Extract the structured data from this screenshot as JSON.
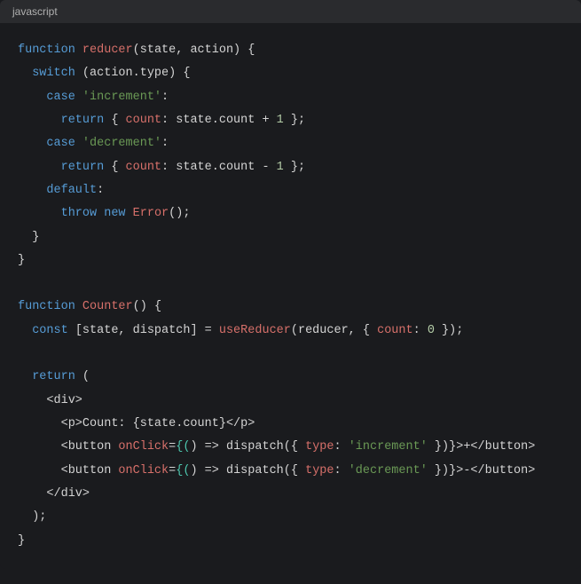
{
  "header": {
    "language": "javascript"
  },
  "code": {
    "l1": {
      "kw": "function",
      "fn": "reducer",
      "params": "(state, action) {"
    },
    "l2": {
      "kw": "switch",
      "expr": " (action.type) {"
    },
    "l3": {
      "kw": "case",
      "str": "'increment'",
      "colon": ":"
    },
    "l4": {
      "kw": "return",
      "brace": " { ",
      "prop": "count",
      "rest": ": state.count + ",
      "num": "1",
      "end": " };"
    },
    "l5": {
      "kw": "case",
      "str": "'decrement'",
      "colon": ":"
    },
    "l6": {
      "kw": "return",
      "brace": " { ",
      "prop": "count",
      "rest": ": state.count - ",
      "num": "1",
      "end": " };"
    },
    "l7": {
      "kw": "default",
      "colon": ":"
    },
    "l8": {
      "kw": "throw",
      "kw2": "new",
      "fn": "Error",
      "end": "();"
    },
    "l9": {
      "brace": "  }"
    },
    "l10": {
      "brace": "}"
    },
    "l11": {
      "kw": "function",
      "fn": "Counter",
      "params": "() {"
    },
    "l12": {
      "kw": "const",
      "lhs": " [state, dispatch] = ",
      "fn": "useReducer",
      "args1": "(reducer, { ",
      "prop": "count",
      "args2": ": ",
      "num": "0",
      "args3": " });"
    },
    "l13": {
      "kw": "return",
      "paren": " ("
    },
    "l14": {
      "txt": "    <div>"
    },
    "l15": {
      "txt": "      <p>Count: {state.count}</p>"
    },
    "l16": {
      "pre": "      <button ",
      "attr": "onClick",
      "eq": "=",
      "bo": "{(",
      "paren": ")",
      "arrow": " => ",
      "call": "dispatch({ ",
      "prop": "type",
      "colon": ": ",
      "str": "'increment'",
      "end": " })}>+</button>"
    },
    "l17": {
      "pre": "      <button ",
      "attr": "onClick",
      "eq": "=",
      "bo": "{(",
      "paren": ")",
      "arrow": " => ",
      "call": "dispatch({ ",
      "prop": "type",
      "colon": ": ",
      "str": "'decrement'",
      "end": " })}>-</button>"
    },
    "l18": {
      "txt": "    </div>"
    },
    "l19": {
      "txt": "  );"
    },
    "l20": {
      "txt": "}"
    }
  }
}
